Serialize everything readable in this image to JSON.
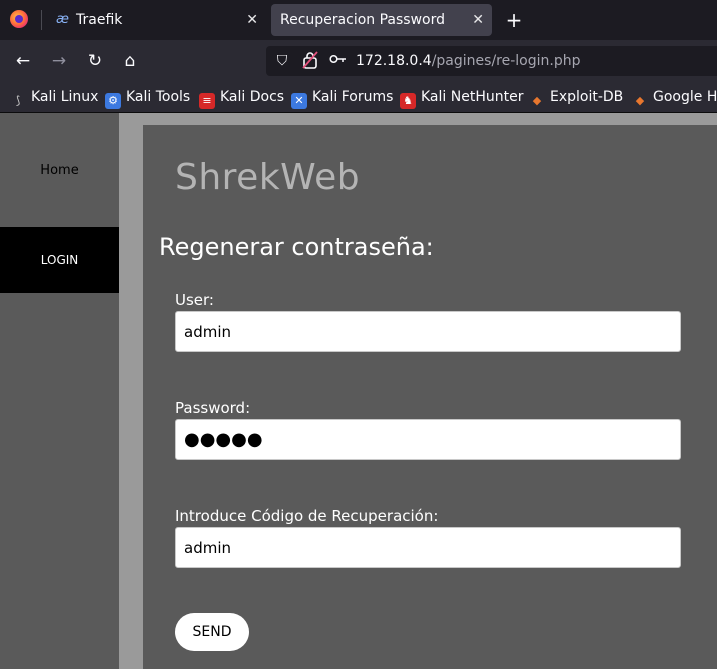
{
  "browser": {
    "tabs": [
      {
        "label": "Traefik",
        "favicon": "æ",
        "active": false
      },
      {
        "label": "Recuperacion Password",
        "active": true
      }
    ],
    "new_tab_label": "+",
    "url_host": "172.18.0.4",
    "url_path": "/pagines/re-login.php",
    "bookmarks": [
      {
        "label": "Kali Linux",
        "icon": "kali-dragon-icon",
        "color": "#a0a0a0"
      },
      {
        "label": "Kali Tools",
        "icon": "kali-tools-icon",
        "color": "#3c79e0"
      },
      {
        "label": "Kali Docs",
        "icon": "kali-docs-icon",
        "color": "#d62828"
      },
      {
        "label": "Kali Forums",
        "icon": "kali-forums-icon",
        "color": "#3c79e0"
      },
      {
        "label": "Kali NetHunter",
        "icon": "nethunter-icon",
        "color": "#d62828"
      },
      {
        "label": "Exploit-DB",
        "icon": "exploit-db-icon",
        "color": "#e8772e"
      },
      {
        "label": "Google Ha",
        "icon": "ghdb-icon",
        "color": "#e8772e"
      }
    ]
  },
  "sidebar": {
    "items": [
      {
        "label": "Home"
      },
      {
        "label": "LOGIN",
        "active": true
      }
    ]
  },
  "main": {
    "brand": "ShrekWeb",
    "form_title": "Regenerar contraseña:",
    "user_label": "User:",
    "user_value": "admin",
    "password_label": "Password:",
    "password_value": "●●●●●",
    "code_label": "Introduce Código de Recuperación:",
    "code_value": "admin",
    "send_label": "SEND"
  }
}
